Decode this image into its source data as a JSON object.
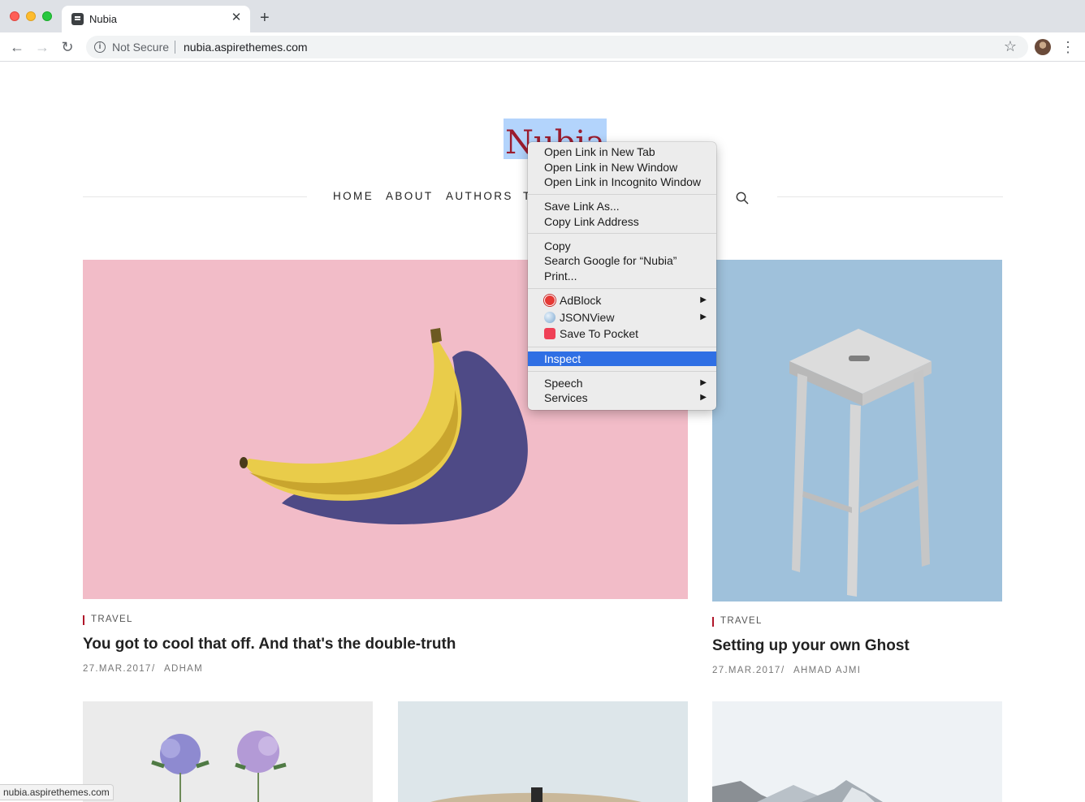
{
  "browser": {
    "tab_title": "Nubia",
    "close_glyph": "✕",
    "new_tab_glyph": "+",
    "back_glyph": "←",
    "forward_glyph": "→",
    "reload_glyph": "↻",
    "security_label": "Not Secure",
    "url": "nubia.aspirethemes.com",
    "star_glyph": "☆",
    "menu_glyph": "⋮"
  },
  "site": {
    "logo": "Nubia",
    "nav": [
      "HOME",
      "ABOUT",
      "AUTHORS",
      "T"
    ]
  },
  "posts": [
    {
      "tag": "TRAVEL",
      "title": "You got to cool that off. And that's the double-truth",
      "date": "27.MAR.2017",
      "sep": "/",
      "author": "ADHAM"
    },
    {
      "tag": "TRAVEL",
      "title": "Setting up your own Ghost",
      "date": "27.MAR.2017",
      "sep": "/",
      "author": "AHMAD AJMI"
    }
  ],
  "context_menu": {
    "items": [
      "Open Link in New Tab",
      "Open Link in New Window",
      "Open Link in Incognito Window",
      "Save Link As...",
      "Copy Link Address",
      "Copy",
      "Search Google for “Nubia”",
      "Print...",
      "AdBlock",
      "JSONView",
      "Save To Pocket",
      "Inspect",
      "Speech",
      "Services"
    ],
    "submenu_glyph": "▶",
    "highlighted": "Inspect"
  },
  "status_bar": {
    "url": "nubia.aspirethemes.com"
  },
  "colors": {
    "accent": "#9b1c2e",
    "selection": "#2f6fe4",
    "banana_bg": "#f2bcc8",
    "stool_bg": "#9fc1db"
  }
}
